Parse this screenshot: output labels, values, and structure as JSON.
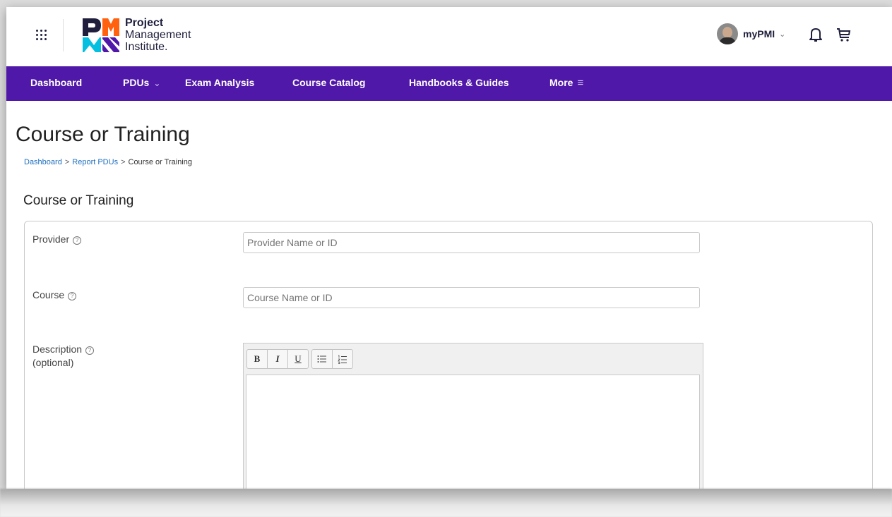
{
  "header": {
    "logo_line1": "Project",
    "logo_line2": "Management",
    "logo_line3": "Institute.",
    "user_label": "myPMI",
    "colors": {
      "brand_purple": "#5018a8",
      "logo_navy": "#1f1f3d",
      "logo_orange": "#ff610f",
      "logo_teal": "#05bfe0"
    }
  },
  "nav": {
    "items": [
      {
        "label": "Dashboard"
      },
      {
        "label": "PDUs"
      },
      {
        "label": "Exam Analysis"
      },
      {
        "label": "Course Catalog"
      },
      {
        "label": "Handbooks & Guides"
      },
      {
        "label": "More"
      }
    ]
  },
  "page": {
    "title": "Course or Training",
    "breadcrumb": [
      "Dashboard",
      "Report PDUs",
      "Course or Training"
    ],
    "section_title": "Course or Training"
  },
  "form": {
    "provider_label": "Provider",
    "provider_placeholder": "Provider Name or ID",
    "course_label": "Course",
    "course_placeholder": "Course Name or ID",
    "description_label": "Description",
    "description_optional": "(optional)",
    "toolbar": {
      "bold": "B",
      "italic": "I",
      "underline": "U"
    }
  }
}
